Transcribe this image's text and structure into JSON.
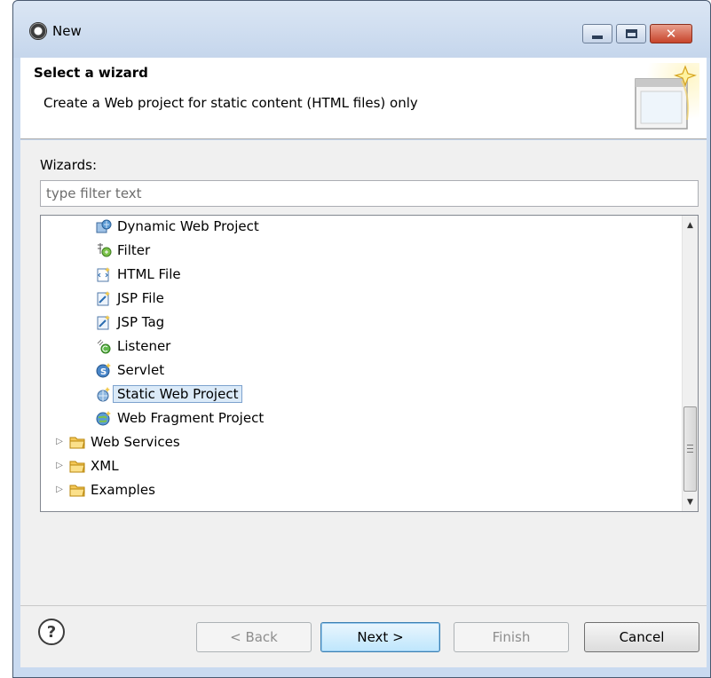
{
  "window": {
    "title": "New"
  },
  "header": {
    "title": "Select a wizard",
    "description": "Create a Web project for static content (HTML files) only"
  },
  "wizards": {
    "label": "Wizards:",
    "filter_placeholder": "type filter text",
    "filter_value": ""
  },
  "tree": {
    "items": [
      {
        "label": "Dynamic Web Project",
        "icon": "dynamic-web-project-icon",
        "level": 2
      },
      {
        "label": "Filter",
        "icon": "filter-icon",
        "level": 2
      },
      {
        "label": "HTML File",
        "icon": "html-file-icon",
        "level": 2
      },
      {
        "label": "JSP File",
        "icon": "jsp-file-icon",
        "level": 2
      },
      {
        "label": "JSP Tag",
        "icon": "jsp-tag-icon",
        "level": 2
      },
      {
        "label": "Listener",
        "icon": "listener-icon",
        "level": 2
      },
      {
        "label": "Servlet",
        "icon": "servlet-icon",
        "level": 2
      },
      {
        "label": "Static Web Project",
        "icon": "static-web-project-icon",
        "level": 2,
        "selected": true
      },
      {
        "label": "Web Fragment Project",
        "icon": "web-fragment-project-icon",
        "level": 2
      },
      {
        "label": "Web Services",
        "icon": "folder-icon",
        "level": 1,
        "expandable": true
      },
      {
        "label": "XML",
        "icon": "folder-icon",
        "level": 1,
        "expandable": true
      },
      {
        "label": "Examples",
        "icon": "folder-icon",
        "level": 1,
        "expandable": true
      }
    ]
  },
  "buttons": {
    "help": "?",
    "back": "< Back",
    "next": "Next >",
    "finish": "Finish",
    "cancel": "Cancel"
  },
  "colors": {
    "title_bar": "#c5d6ec",
    "close_button": "#c7442b",
    "selection_bg": "#dbeaf8",
    "selection_border": "#7da2ce",
    "default_button": "#3c7fb1"
  }
}
